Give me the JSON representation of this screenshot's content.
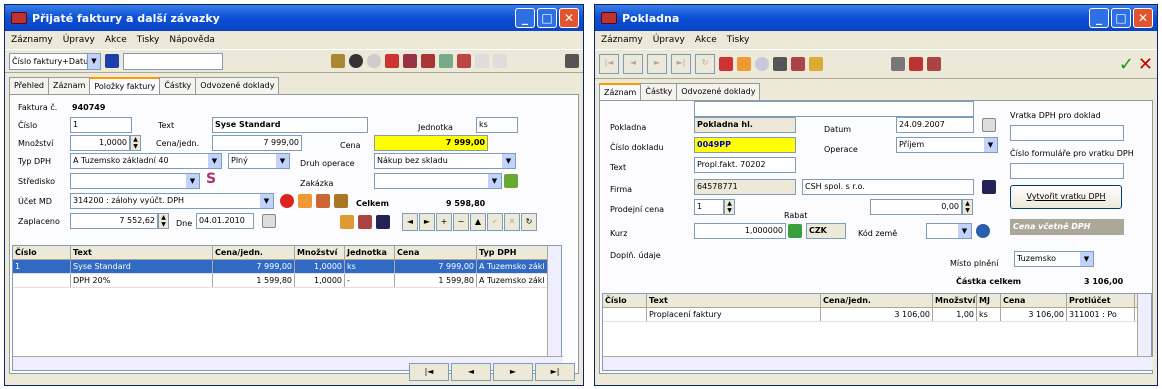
{
  "left": {
    "title": "Přijaté faktury a další závazky",
    "menu": [
      "Záznamy",
      "Úpravy",
      "Akce",
      "Tisky",
      "Nápověda"
    ],
    "sort_combo": "Číslo faktury+Datum",
    "tabs": [
      "Přehled",
      "Záznam",
      "Položky faktury",
      "Částky",
      "Odvozené doklady"
    ],
    "form": {
      "faktura_label": "Faktura č.",
      "faktura_value": "940749",
      "cislo_label": "Číslo",
      "cislo_value": "1",
      "text_label": "Text",
      "text_value": "Syse Standard",
      "jednotka_label": "Jednotka",
      "jednotka_value": "ks",
      "mnozstvi_label": "Množství",
      "mnozstvi_value": "1,0000",
      "cenajedn_label": "Cena/jedn.",
      "cenajedn_value": "7 999,00",
      "cena_label": "Cena",
      "cena_value": "7 999,00",
      "typdph_label": "Typ DPH",
      "typdph_value": "A Tuzemsko základní 40",
      "plny_value": "Plný",
      "druh_label": "Druh operace",
      "druh_value": "Nákup bez skladu",
      "stredisko_label": "Středisko",
      "zakazka_label": "Zakázka",
      "ucet_label": "Účet MD",
      "ucet_value": "314200 : zálohy vyúčt. DPH",
      "celkem_label": "Celkem",
      "celkem_value": "9 598,80",
      "zaplaceno_label": "Zaplaceno",
      "zaplaceno_value": "7 552,62",
      "dne_label": "Dne",
      "dne_value": "04.01.2010"
    },
    "grid": {
      "headers": [
        "Číslo",
        "Text",
        "Cena/jedn.",
        "Množství",
        "Jednotka",
        "Cena",
        "Typ DPH"
      ],
      "rows": [
        [
          "1",
          "Syse Standard",
          "7 999,00",
          "1,0000",
          "ks",
          "7 999,00",
          "A Tuzemsko zákl"
        ],
        [
          "",
          "DPH 20%",
          "1 599,80",
          "1,0000",
          "-",
          "1 599,80",
          "A Tuzemsko zákl"
        ]
      ]
    },
    "nav": [
      "|◄",
      "◄",
      "►",
      "►|"
    ]
  },
  "right": {
    "title": "Pokladna",
    "menu": [
      "Záznamy",
      "Úpravy",
      "Akce",
      "Tisky"
    ],
    "tabs": [
      "Záznam",
      "Částky",
      "Odvozené doklady"
    ],
    "form": {
      "pokladna_label": "Pokladna",
      "pokladna_value": "Pokladna hl.",
      "datum_label": "Datum",
      "datum_value": "24.09.2007",
      "vratka_label": "Vratka DPH pro doklad",
      "cislodokladu_label": "Číslo dokladu",
      "cislodokladu_value": "0049PP",
      "operace_label": "Operace",
      "operace_value": "Příjem",
      "cisloform_label": "Číslo formuláře pro vratku DPH",
      "text_label": "Text",
      "text_value": "Propl.fakt. 70202",
      "firma_label": "Firma",
      "firma_ico": "64578771",
      "firma_name": "CSH spol. s r.o.",
      "vytvorit_button": "Vytvořit vratku DPH",
      "prodejni_label": "Prodejní cena",
      "prodejni_value": "1",
      "rabat_label": "Rabat",
      "rabat_value": "0,00",
      "kurz_label": "Kurz",
      "kurz_value": "1,000000",
      "mena_value": "CZK",
      "kodzeme_label": "Kód země",
      "cena_dph_label": "Cena včetně DPH",
      "dopln_label": "Doplň. údaje",
      "misto_label": "Místo plnění",
      "misto_value": "Tuzemsko",
      "castka_label": "Částka celkem",
      "castka_value": "3 106,00"
    },
    "grid": {
      "headers": [
        "Číslo",
        "Text",
        "Cena/jedn.",
        "Množství",
        "MJ",
        "Cena",
        "Protiúčet"
      ],
      "rows": [
        [
          "",
          "Proplacení faktury",
          "3 106,00",
          "1,00",
          "ks",
          "3 106,00",
          "311001 : Po"
        ]
      ]
    }
  }
}
